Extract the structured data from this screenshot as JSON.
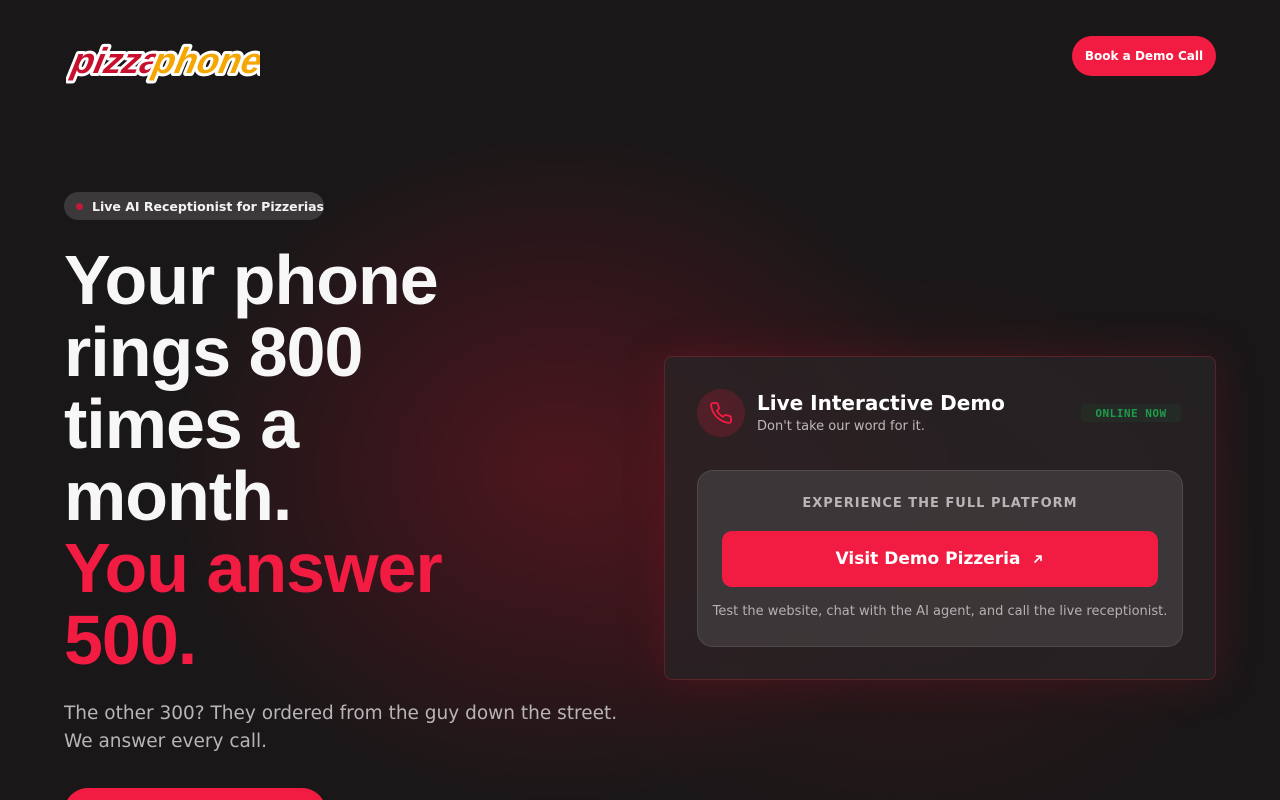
{
  "brand": {
    "logo_text_a": "pizza",
    "logo_text_b": "phone.ai",
    "accent": "#f21c42"
  },
  "header": {
    "cta_label": "Book a Demo Call"
  },
  "hero": {
    "badge": "Live AI Receptionist for Pizzerias",
    "headline_white": [
      "Your phone",
      "rings 800",
      "times a",
      "month."
    ],
    "headline_red": [
      "You answer",
      "500."
    ],
    "subtext": "The other 300? They ordered from the guy down the street. We answer every call."
  },
  "demo_card": {
    "icon": "phone-icon",
    "title": "Live Interactive Demo",
    "subtitle": "Don't take our word for it.",
    "status": "ONLINE NOW",
    "status_color": "#1f9a4b",
    "section_label": "EXPERIENCE THE FULL PLATFORM",
    "button_label": "Visit Demo Pizzeria",
    "button_icon": "external-arrow-icon",
    "note": "Test the website, chat with the AI agent, and call the live receptionist."
  }
}
